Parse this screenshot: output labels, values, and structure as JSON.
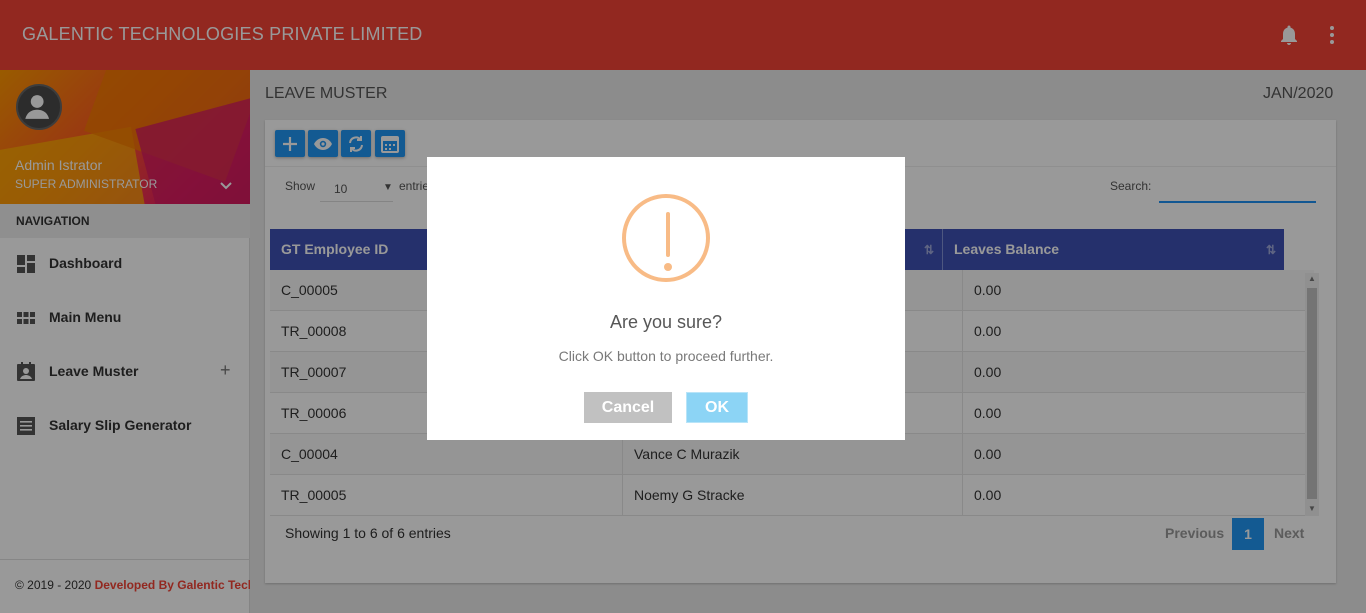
{
  "header": {
    "title": "GALENTIC TECHNOLOGIES PRIVATE LIMITED",
    "icons": [
      "bell-icon",
      "more-vertical-icon"
    ]
  },
  "colors": {
    "primary": "#f44336",
    "accent": "#2196f3",
    "table_header": "#3f51b5",
    "warning": "#f8bb86",
    "ok_button": "#8cd4f5",
    "cancel_button": "#c1c1c1"
  },
  "sidebar": {
    "user": {
      "name": "Admin Istrator",
      "role": "SUPER ADMINISTRATOR"
    },
    "nav_header": "NAVIGATION",
    "items": [
      {
        "label": "Dashboard",
        "icon": "dashboard-icon"
      },
      {
        "label": "Main Menu",
        "icon": "grid-icon"
      },
      {
        "label": "Leave Muster",
        "icon": "contact-calendar-icon",
        "expand": "+"
      },
      {
        "label": "Salary Slip Generator",
        "icon": "list-icon"
      }
    ],
    "footer": {
      "copyright": "© 2019 - 2020",
      "developer": "Developed By Galentic Technologies"
    }
  },
  "page": {
    "title": "LEAVE MUSTER",
    "period": "JAN/2020"
  },
  "toolbar": {
    "buttons": [
      "add-icon",
      "view-icon",
      "refresh-icon",
      "calendar-icon"
    ]
  },
  "table_controls": {
    "show_label": "Show",
    "page_size": "10",
    "entries_label": "entries",
    "search_label": "Search:",
    "search_value": ""
  },
  "table": {
    "columns": [
      "GT Employee ID",
      "",
      "Leaves Balance"
    ],
    "rows": [
      {
        "id": "C_00005",
        "name": "",
        "balance": "0.00"
      },
      {
        "id": "TR_00008",
        "name": "",
        "balance": "0.00"
      },
      {
        "id": "TR_00007",
        "name": "",
        "balance": "0.00"
      },
      {
        "id": "TR_00006",
        "name": "",
        "balance": "0.00"
      },
      {
        "id": "C_00004",
        "name": "Vance C Murazik",
        "balance": "0.00"
      },
      {
        "id": "TR_00005",
        "name": "Noemy G Stracke",
        "balance": "0.00"
      }
    ]
  },
  "pagination": {
    "info": "Showing 1 to 6 of 6 entries",
    "previous": "Previous",
    "current": "1",
    "next": "Next"
  },
  "dialog": {
    "title": "Are you sure?",
    "text": "Click OK button to proceed further.",
    "cancel": "Cancel",
    "ok": "OK"
  }
}
